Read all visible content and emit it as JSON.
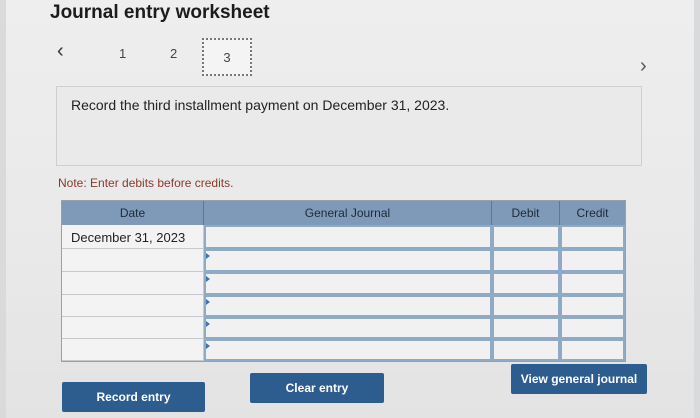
{
  "title": "Journal entry worksheet",
  "nav": {
    "prev_icon": "‹",
    "next_icon": "›",
    "steps": [
      "1",
      "2",
      "3"
    ]
  },
  "instruction": "Record the third installment payment on December 31, 2023.",
  "note": "Note: Enter debits before credits.",
  "table": {
    "headers": {
      "date": "Date",
      "general_journal": "General Journal",
      "debit": "Debit",
      "credit": "Credit"
    },
    "rows": [
      {
        "date": "December 31, 2023",
        "account": "",
        "debit": "",
        "credit": ""
      },
      {
        "date": "",
        "account": "",
        "debit": "",
        "credit": ""
      },
      {
        "date": "",
        "account": "",
        "debit": "",
        "credit": ""
      },
      {
        "date": "",
        "account": "",
        "debit": "",
        "credit": ""
      },
      {
        "date": "",
        "account": "",
        "debit": "",
        "credit": ""
      },
      {
        "date": "",
        "account": "",
        "debit": "",
        "credit": ""
      }
    ]
  },
  "buttons": {
    "record": "Record entry",
    "clear": "Clear entry",
    "view": "View general journal"
  }
}
